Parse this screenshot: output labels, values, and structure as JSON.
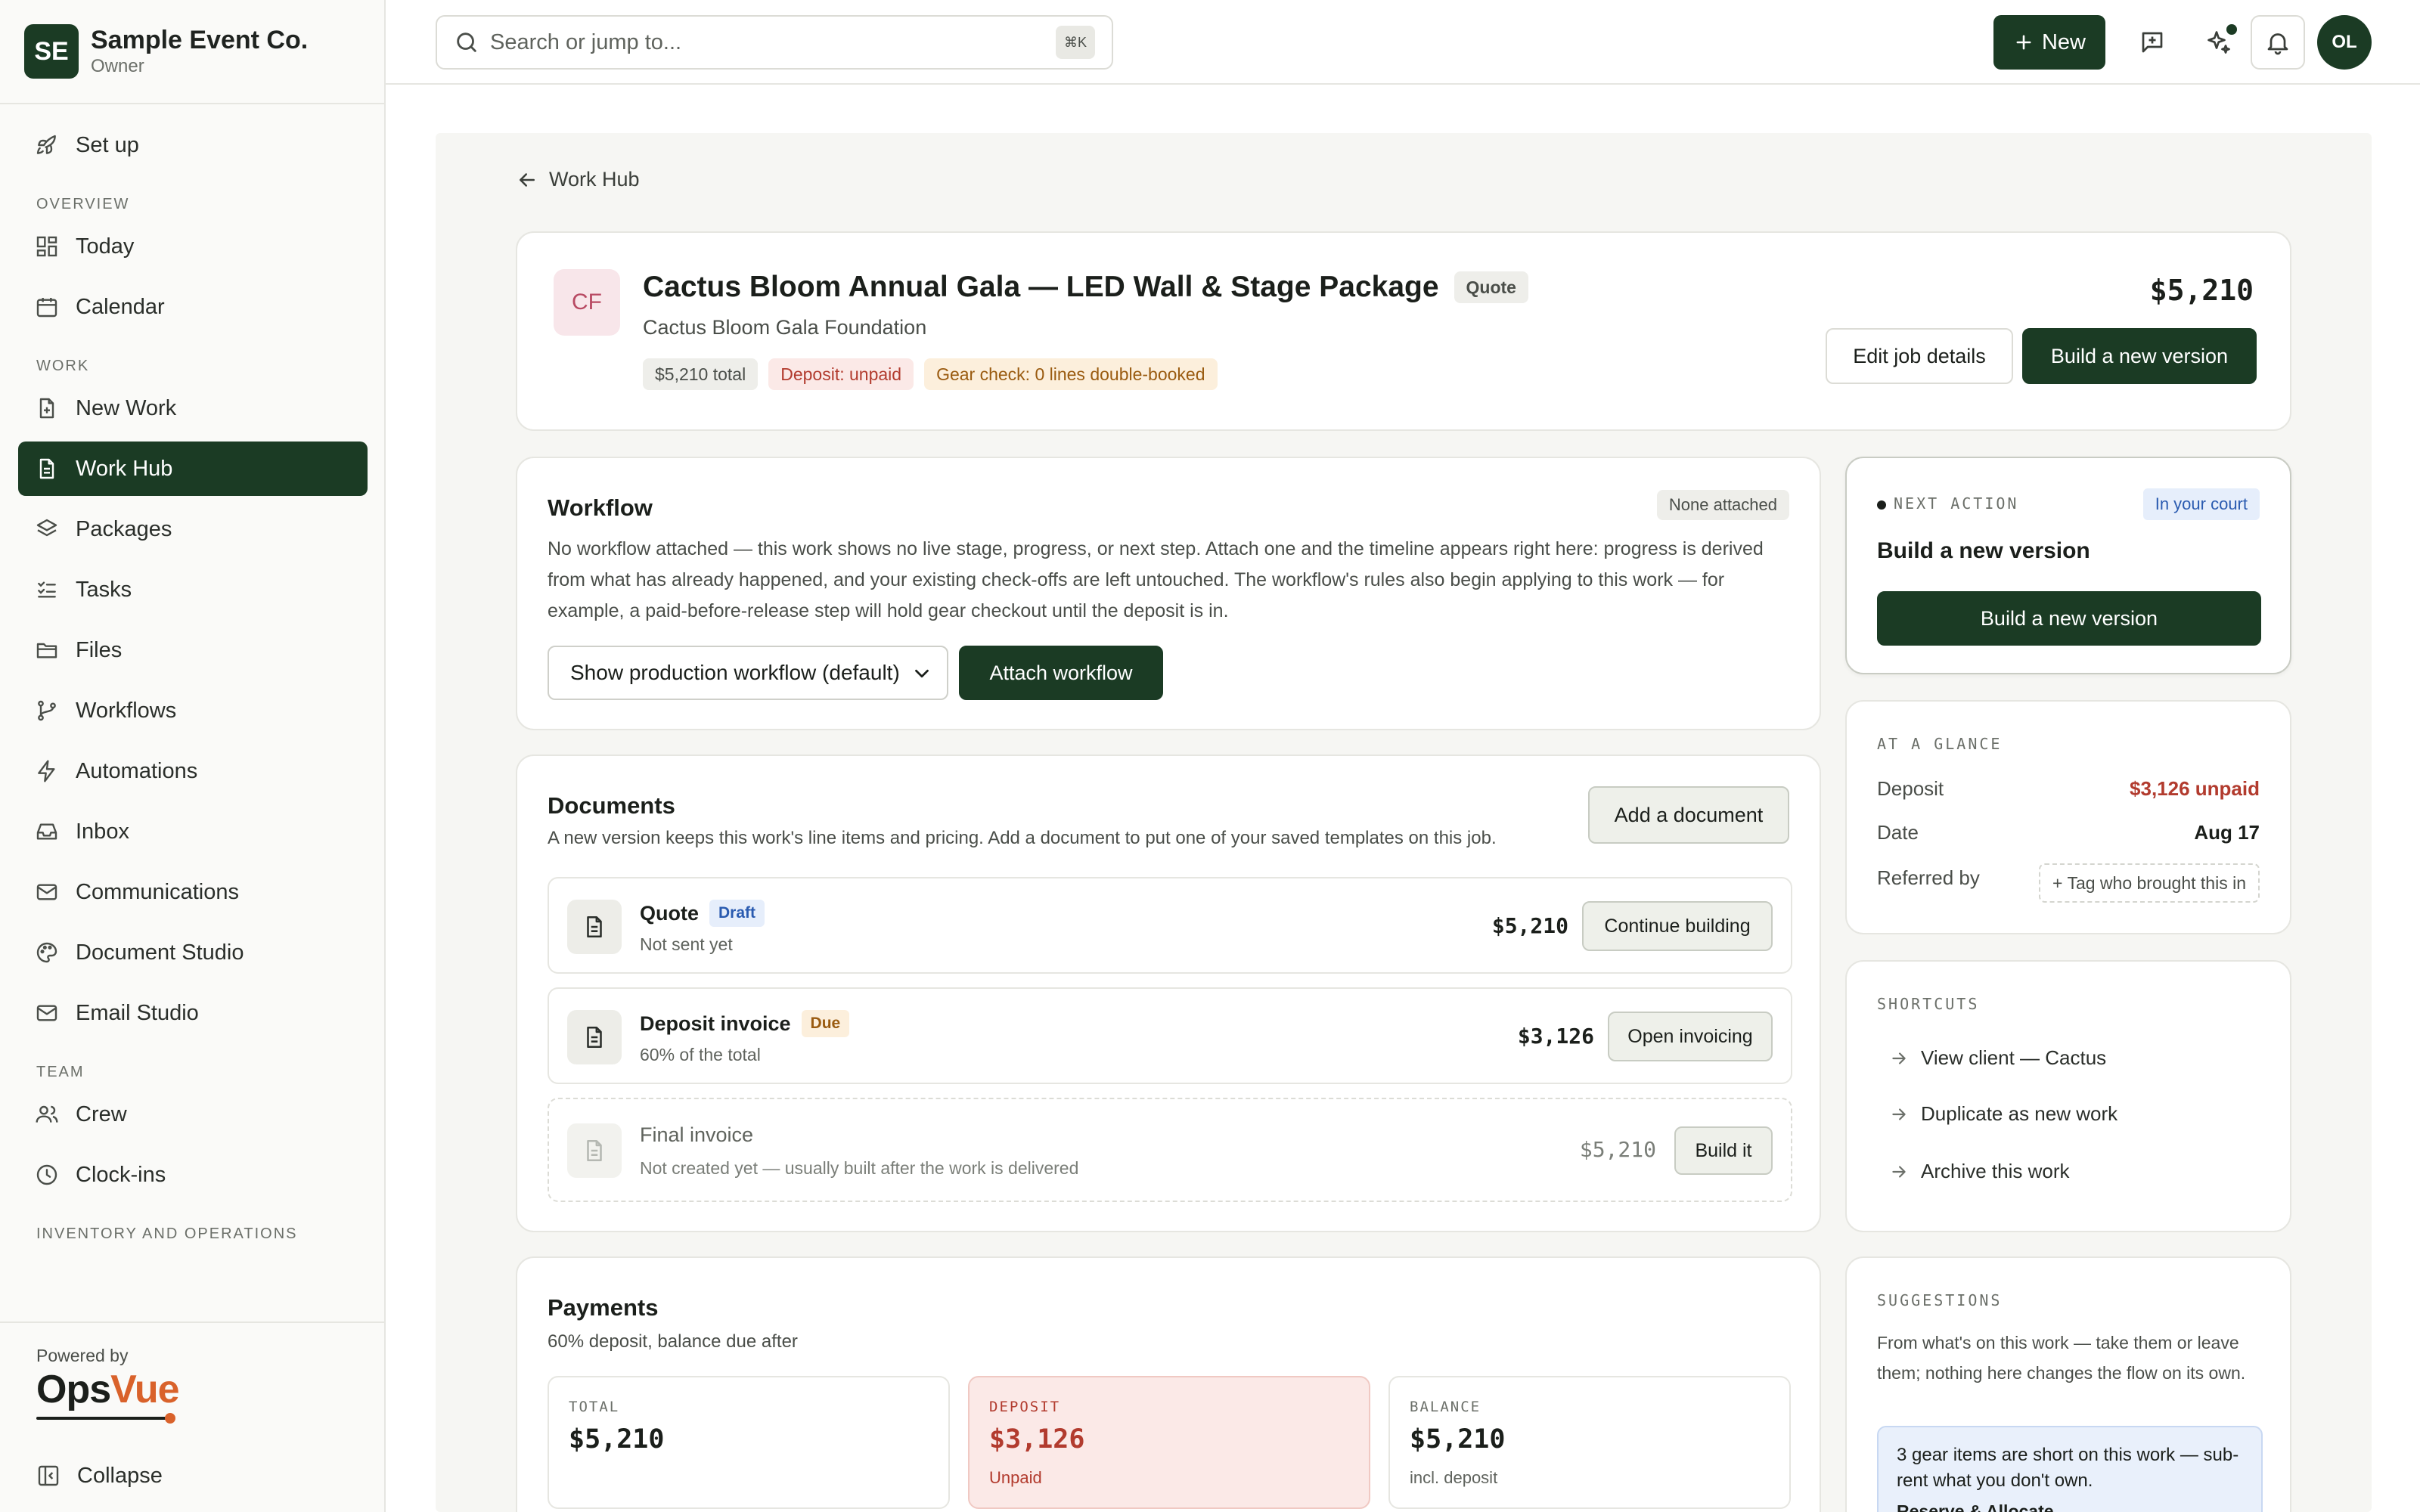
{
  "org": {
    "initials": "SE",
    "name": "Sample Event Co.",
    "role": "Owner"
  },
  "nav": {
    "setup": "Set up",
    "overview_label": "OVERVIEW",
    "today": "Today",
    "calendar": "Calendar",
    "work_label": "WORK",
    "new_work": "New Work",
    "work_hub": "Work Hub",
    "packages": "Packages",
    "tasks": "Tasks",
    "files": "Files",
    "workflows": "Workflows",
    "automations": "Automations",
    "inbox": "Inbox",
    "communications": "Communications",
    "document_studio": "Document Studio",
    "email_studio": "Email Studio",
    "team_label": "TEAM",
    "crew": "Crew",
    "clock_ins": "Clock-ins",
    "inventory_label": "INVENTORY AND OPERATIONS"
  },
  "footer": {
    "powered_by": "Powered by",
    "logo_ops": "Ops",
    "logo_vue": "Vue",
    "collapse": "Collapse"
  },
  "topbar": {
    "search_placeholder": "Search or jump to...",
    "shortcut": "⌘K",
    "new_label": "New",
    "user_initials": "OL"
  },
  "breadcrumb": {
    "back_label": "Work Hub"
  },
  "job": {
    "client_initials": "CF",
    "title": "Cactus Bloom Annual Gala — LED Wall & Stage Package",
    "type_badge": "Quote",
    "client": "Cactus Bloom Gala Foundation",
    "pill_total": "$5,210 total",
    "pill_deposit": "Deposit: unpaid",
    "pill_gear": "Gear check: 0 lines double-booked",
    "amount": "$5,210",
    "edit_label": "Edit job details",
    "build_label": "Build a new version"
  },
  "workflow": {
    "title": "Workflow",
    "badge": "None attached",
    "description": "No workflow attached — this work shows no live stage, progress, or next step. Attach one and the timeline appears right here: progress is derived from what has already happened, and your existing check-offs are left untouched. The workflow's rules also begin applying to this work — for example, a paid-before-release step will hold gear checkout until the deposit is in.",
    "select_value": "Show production workflow (default)",
    "attach_label": "Attach workflow"
  },
  "documents": {
    "title": "Documents",
    "description": "A new version keeps this work's line items and pricing. Add a document to put one of your saved templates on this job.",
    "add_label": "Add a document",
    "rows": [
      {
        "name": "Quote",
        "tag": "Draft",
        "sub": "Not sent yet",
        "amount": "$5,210",
        "action": "Continue building"
      },
      {
        "name": "Deposit invoice",
        "tag": "Due",
        "sub": "60% of the total",
        "amount": "$3,126",
        "action": "Open invoicing"
      },
      {
        "name": "Final invoice",
        "sub": "Not created yet — usually built after the work is delivered",
        "amount": "$5,210",
        "action": "Build it"
      }
    ]
  },
  "payments": {
    "title": "Payments",
    "subtitle": "60% deposit, balance due after",
    "total_label": "TOTAL",
    "total_value": "$5,210",
    "deposit_label": "DEPOSIT",
    "deposit_value": "$3,126",
    "deposit_sub": "Unpaid",
    "balance_label": "BALANCE",
    "balance_value": "$5,210",
    "balance_sub": "incl. deposit"
  },
  "next_action": {
    "label": "NEXT ACTION",
    "badge": "In your court",
    "title": "Build a new version",
    "button": "Build a new version"
  },
  "glance": {
    "label": "AT A GLANCE",
    "deposit_k": "Deposit",
    "deposit_v": "$3,126 unpaid",
    "date_k": "Date",
    "date_v": "Aug 17",
    "referred_k": "Referred by",
    "referred_v": "+ Tag who brought this in"
  },
  "shortcuts": {
    "label": "SHORTCUTS",
    "items": [
      "View client — Cactus",
      "Duplicate as new work",
      "Archive this work"
    ]
  },
  "suggestions": {
    "label": "SUGGESTIONS",
    "text": "From what's on this work — take them or leave them; nothing here changes the flow on its own.",
    "alert": "3 gear items are short on this work — sub-rent what you don't own.",
    "alert_link": "Reserve & Allocate →"
  },
  "colors": {
    "brand": "#1b3b24",
    "accent_orange": "#d9622b",
    "danger": "#b23b2e"
  }
}
